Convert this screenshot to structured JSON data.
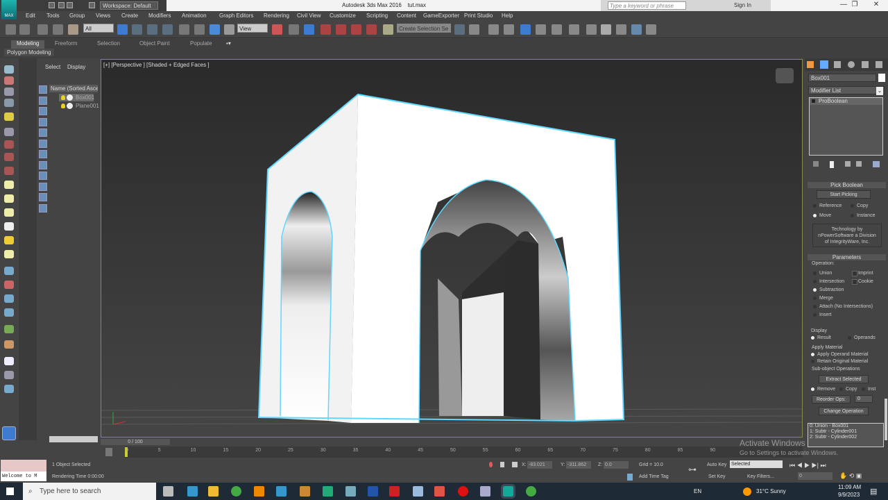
{
  "titlebar": {
    "app_title": "Autodesk 3ds Max 2016",
    "file": "tut.max",
    "logo": "MAX",
    "workspace": "Workspace: Default",
    "search_placeholder": "Type a keyword or phrase",
    "sign_in": "Sign In",
    "minimize": "—",
    "restore": "❐",
    "close": "✕"
  },
  "menu": [
    "Edit",
    "Tools",
    "Group",
    "Views",
    "Create",
    "Modifiers",
    "Animation",
    "Graph Editors",
    "Rendering",
    "Civil View",
    "Customize",
    "Scripting",
    "Content",
    "GameExporter",
    "Print Studio",
    "Help"
  ],
  "toolbar": {
    "filter": "All",
    "ref_coord": "View",
    "selection_set": "Create Selection Se"
  },
  "ribbon": {
    "tabs": [
      "Modeling",
      "Freeform",
      "Selection",
      "Object Paint",
      "Populate"
    ],
    "active": "Modeling",
    "panel": "Polygon Modeling"
  },
  "explorer": {
    "tabs": [
      "Select",
      "Display"
    ],
    "column": "Name (Sorted Ascending)",
    "items": [
      {
        "name": "Box001",
        "selected": true
      },
      {
        "name": "Plane001",
        "selected": false
      }
    ]
  },
  "viewport": {
    "label": "[+] [Perspective ] [Shaded + Edged Faces ]",
    "accent": "#5fd7ff"
  },
  "command_panel": {
    "object_name": "Box001",
    "modifier_list": "Modifier List",
    "stack": [
      "ProBoolean"
    ],
    "pick_boolean": {
      "title": "Pick Boolean",
      "start_picking": "Start Picking",
      "options": [
        "Reference",
        "Copy",
        "Move",
        "Instance"
      ],
      "selected": "Move",
      "tech": [
        "Technology by",
        "nPowerSoftware a Division",
        "of IntegrityWare, Inc."
      ]
    },
    "parameters": {
      "title": "Parameters",
      "operation_label": "Operation:",
      "operations": [
        "Union",
        "Intersection",
        "Subtraction",
        "Merge",
        "Attach (No Intersections)",
        "Insert"
      ],
      "selected": "Subtraction",
      "checks": [
        "Imprint",
        "Cookie"
      ],
      "display_label": "Display",
      "display": [
        "Result",
        "Operands"
      ],
      "material_label": "Apply Material",
      "material": [
        "Apply Operand Material",
        "Retain Original Material"
      ],
      "subobj_label": "Sub-object Operations",
      "extract": "Extract Selected",
      "subobj": [
        "Remove",
        "Copy",
        "Inst"
      ],
      "reorder": "Reorder Ops:",
      "reorder_value": "0",
      "change_op": "Change Operation",
      "ops_list": [
        "0: Union - Box001",
        "1: Subtr - Cylinder001",
        "2: Subtr - Cylinder002"
      ]
    }
  },
  "timeline": {
    "position": "0 / 100",
    "ticks": [
      "0",
      "5",
      "10",
      "15",
      "20",
      "25",
      "30",
      "35",
      "40",
      "45",
      "50",
      "55",
      "60",
      "65",
      "70",
      "75",
      "80",
      "85",
      "90"
    ]
  },
  "status": {
    "selected": "1 Object Selected",
    "render_time": "Rendering Time 0:00:00",
    "maxscript": "Welcome to M",
    "x_label": "X:",
    "x": "-83.021",
    "y_label": "Y:",
    "y": "-311.862",
    "z_label": "Z:",
    "z": "0.0",
    "grid": "Grid = 10.0",
    "add_time_tag": "Add Time Tag",
    "auto_key": "Auto Key",
    "set_key": "Set Key",
    "key_mode": "Selected",
    "key_filters": "Key Filters...",
    "frame": "0"
  },
  "watermark": [
    "Activate Windows",
    "Go to Settings to activate Windows."
  ],
  "taskbar": {
    "search": "Type here to search",
    "weather": "31°C  Sunny",
    "lang": "EN",
    "time": "11:09 AM",
    "date": "9/9/2023"
  }
}
